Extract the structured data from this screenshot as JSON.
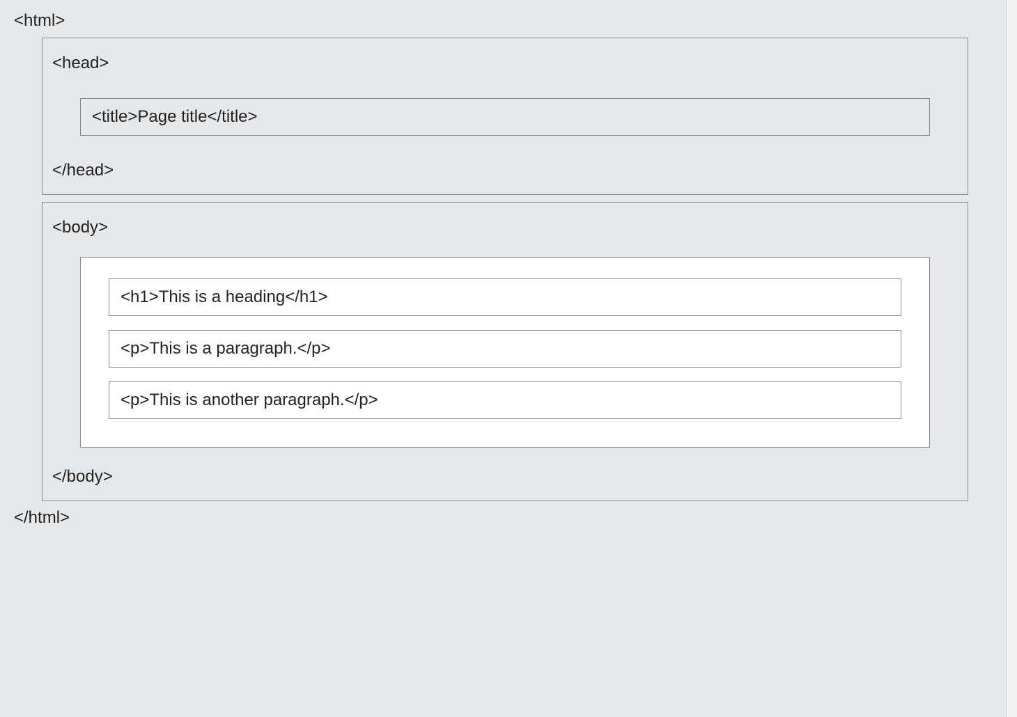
{
  "tags": {
    "html_open": "<html>",
    "html_close": "</html>",
    "head_open": "<head>",
    "head_close": "</head>",
    "title_open": "<title>",
    "title_close": "</title>",
    "body_open": "<body>",
    "body_close": "</body>",
    "h1_open": "<h1>",
    "h1_close": "</h1>",
    "p_open": "<p>",
    "p_close": "</p>"
  },
  "content": {
    "title": "Page title",
    "heading": "This is a heading",
    "paragraph1": "This is a paragraph.",
    "paragraph2": "This is another paragraph."
  }
}
